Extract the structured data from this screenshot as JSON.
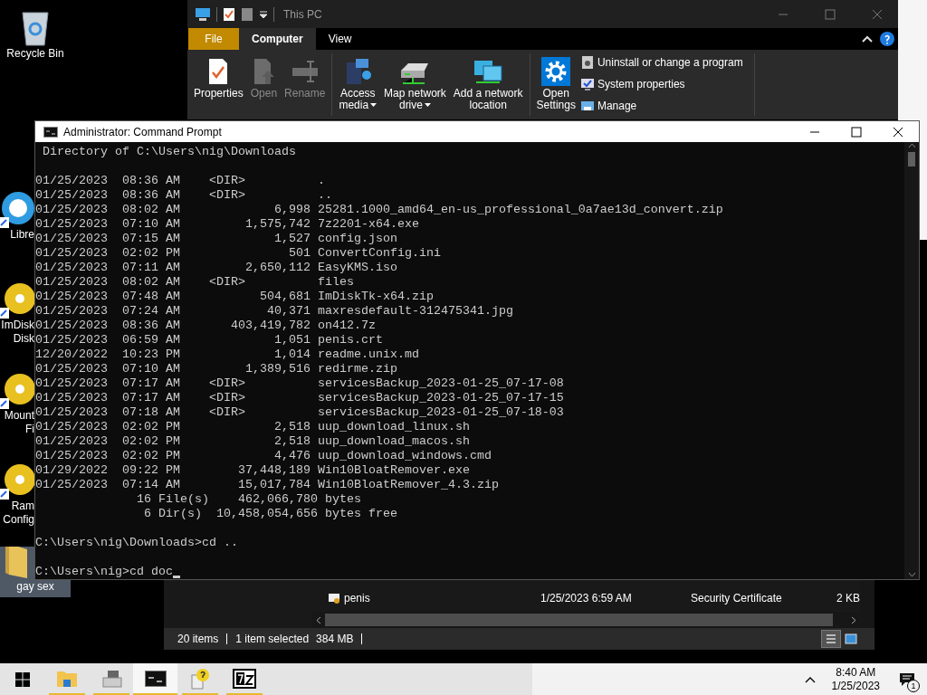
{
  "desktop_icons": [
    {
      "kind": "recycle",
      "lines": [
        "Recycle Bin"
      ],
      "selected": false
    },
    {
      "kind": "sync",
      "lines": [
        "Libre"
      ],
      "selected": false
    },
    {
      "kind": "disc",
      "lines": [
        "ImDisk",
        "Disk"
      ],
      "selected": false
    },
    {
      "kind": "disc",
      "lines": [
        "Mount",
        "Fi"
      ],
      "selected": false
    },
    {
      "kind": "disc",
      "lines": [
        "Ram",
        "Config"
      ],
      "selected": false
    },
    {
      "kind": "folder",
      "lines": [
        "gay sex"
      ],
      "selected": true
    }
  ],
  "explorer_top": {
    "title": "This PC",
    "tabs": [
      {
        "label": "File",
        "kind": "file",
        "selected": false
      },
      {
        "label": "Computer",
        "kind": "tab",
        "selected": true
      },
      {
        "label": "View",
        "kind": "tab",
        "selected": false
      }
    ],
    "groups": [
      {
        "buttons": [
          {
            "kind": "properties",
            "lines": [
              "Properties"
            ],
            "disabled": false,
            "dropdown": false
          },
          {
            "kind": "open",
            "lines": [
              "Open"
            ],
            "disabled": true,
            "dropdown": false
          },
          {
            "kind": "rename",
            "lines": [
              "Rename"
            ],
            "disabled": true,
            "dropdown": false
          }
        ]
      },
      {
        "buttons": [
          {
            "kind": "media",
            "lines": [
              "Access",
              "media"
            ],
            "disabled": false,
            "dropdown": true
          },
          {
            "kind": "drive",
            "lines": [
              "Map network",
              "drive"
            ],
            "disabled": false,
            "dropdown": true
          },
          {
            "kind": "netloc",
            "lines": [
              "Add a network",
              "location"
            ],
            "disabled": false,
            "dropdown": false
          }
        ]
      },
      {
        "buttons": [
          {
            "kind": "settings",
            "lines": [
              "Open",
              "Settings"
            ],
            "disabled": false,
            "dropdown": false
          }
        ],
        "small": [
          {
            "kind": "uninstall",
            "label": "Uninstall or change a program"
          },
          {
            "kind": "sysprops",
            "label": "System properties"
          },
          {
            "kind": "manage",
            "label": "Manage"
          }
        ]
      }
    ]
  },
  "cmd": {
    "title": "Administrator: Command Prompt",
    "cursor": true,
    "blocks": [
      [
        " Directory of C:\\Users\\nig\\Downloads"
      ],
      [
        "01/25/2023  08:36 AM    <DIR>          .",
        "01/25/2023  08:36 AM    <DIR>          ..",
        "01/25/2023  08:02 AM             6,998 25281.1000_amd64_en-us_professional_0a7ae13d_convert.zip",
        "01/25/2023  07:10 AM         1,575,742 7z2201-x64.exe",
        "01/25/2023  07:15 AM             1,527 config.json",
        "01/25/2023  02:02 PM               501 ConvertConfig.ini",
        "01/25/2023  07:11 AM         2,650,112 EasyKMS.iso",
        "01/25/2023  08:02 AM    <DIR>          files",
        "01/25/2023  07:48 AM           504,681 ImDiskTk-x64.zip",
        "01/25/2023  07:24 AM            40,371 maxresdefault-312475341.jpg",
        "01/25/2023  08:36 AM       403,419,782 on412.7z",
        "01/25/2023  06:59 AM             1,051 penis.crt",
        "12/20/2022  10:23 PM             1,014 readme.unix.md",
        "01/25/2023  07:10 AM         1,389,516 redirme.zip",
        "01/25/2023  07:17 AM    <DIR>          servicesBackup_2023-01-25_07-17-08",
        "01/25/2023  07:17 AM    <DIR>          servicesBackup_2023-01-25_07-17-15",
        "01/25/2023  07:18 AM    <DIR>          servicesBackup_2023-01-25_07-18-03",
        "01/25/2023  02:02 PM             2,518 uup_download_linux.sh",
        "01/25/2023  02:02 PM             2,518 uup_download_macos.sh",
        "01/25/2023  02:02 PM             4,476 uup_download_windows.cmd",
        "01/29/2022  09:22 PM        37,448,189 Win10BloatRemover.exe",
        "01/25/2023  07:14 AM        15,017,784 Win10BloatRemover_4.3.zip",
        "              16 File(s)    462,066,780 bytes",
        "               6 Dir(s)  10,458,054,656 bytes free"
      ],
      [
        "C:\\Users\\nig\\Downloads>cd .."
      ],
      [
        "C:\\Users\\nig>cd doc"
      ]
    ]
  },
  "explorer_bottom": {
    "rows": [
      {
        "kind": "cert",
        "name": "penis",
        "date": "1/25/2023 6:59 AM",
        "type": "Security Certificate",
        "size": "2 KB"
      }
    ],
    "status": {
      "items": "20 items",
      "selected": "1 item selected",
      "size": "384 MB"
    },
    "views": [
      {
        "kind": "details",
        "selected": true
      },
      {
        "kind": "tiles",
        "selected": false
      }
    ]
  },
  "taskbar": {
    "apps": [
      {
        "kind": "folder",
        "running": true,
        "selected": false
      },
      {
        "kind": "printer",
        "running": true,
        "selected": false
      },
      {
        "kind": "cmd",
        "running": true,
        "selected": true
      },
      {
        "kind": "help",
        "running": true,
        "selected": false
      },
      {
        "kind": "sevenzip",
        "running": true,
        "selected": false
      }
    ],
    "time": "8:40 AM",
    "date": "1/25/2023",
    "notifications": "1"
  }
}
